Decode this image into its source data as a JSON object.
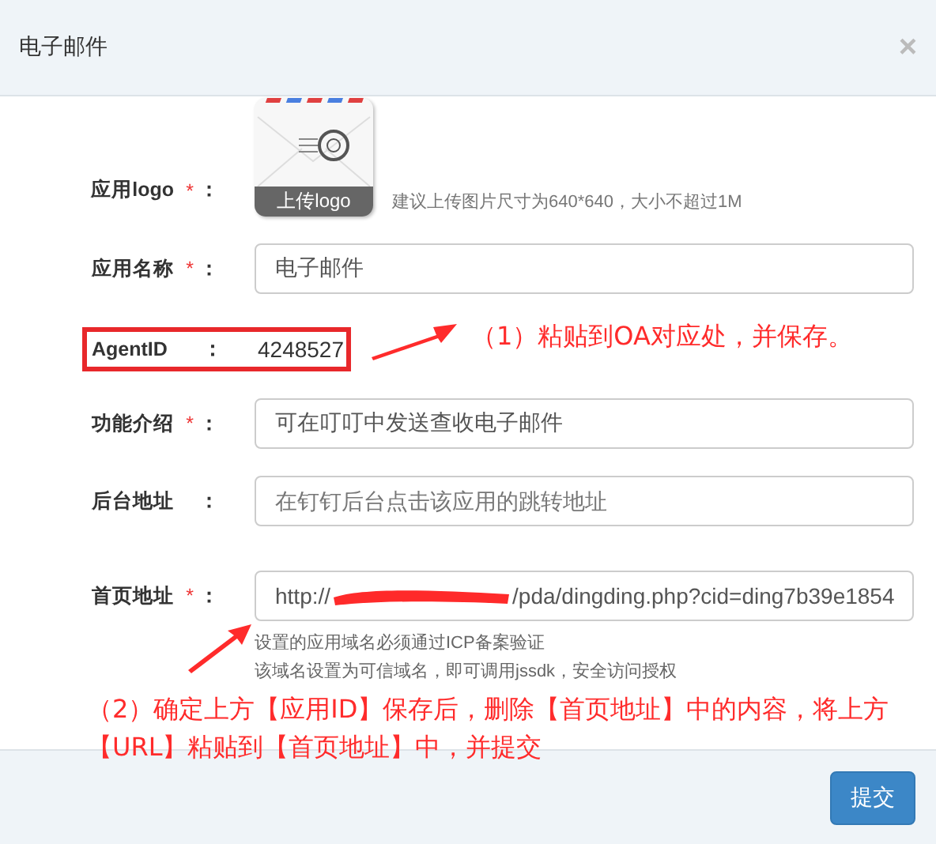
{
  "window": {
    "title": "电子邮件",
    "close": "×"
  },
  "logo": {
    "label": "应用logo",
    "marker": "*",
    "colon": "：",
    "upload": "上传logo",
    "hint": "建议上传图片尺寸为640*640，大小不超过1M"
  },
  "fields": [
    {
      "kind": "input",
      "label": "应用名称",
      "marker": "*",
      "colon": "：",
      "value": "电子邮件"
    },
    {
      "kind": "static",
      "label": "AgentID",
      "colon": "：",
      "value": "4248527",
      "highlighted": true
    },
    {
      "kind": "input",
      "label": "功能介绍",
      "marker": "*",
      "colon": "：",
      "value": "可在叮叮中发送查收电子邮件"
    },
    {
      "kind": "input",
      "label": "后台地址",
      "colon": "：",
      "placeholder": "在钉钉后台点击该应用的跳转地址"
    },
    {
      "kind": "url",
      "label": "首页地址",
      "marker": "*",
      "colon": "：",
      "value_start": "http://",
      "value_end": "/pda/dingding.php?cid=ding7b39e1854",
      "redacted": true,
      "hints": [
        "设置的应用域名必须通过ICP备案验证",
        "该域名设置为可信域名，即可调用jssdk，安全访问授权"
      ]
    }
  ],
  "annotations": [
    {
      "text": "（1）粘贴到OA对应处，并保存。"
    },
    {
      "text": "（2）确定上方【应用ID】保存后，删除【首页地址】中的内容，将上方【URL】粘贴到【首页地址】中，并提交"
    }
  ],
  "buttons": [
    {
      "label": "提交"
    }
  ]
}
